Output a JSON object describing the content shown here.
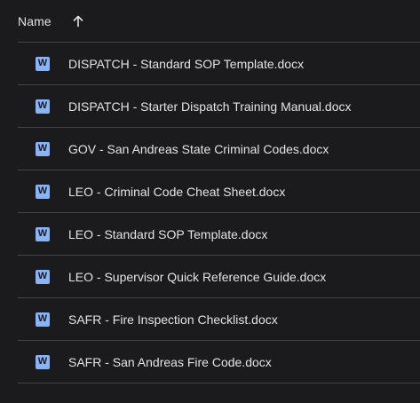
{
  "header": {
    "name_label": "Name",
    "sort_icon": "arrow-up-icon"
  },
  "colors": {
    "background": "#1b1b1e",
    "divider": "#444448",
    "text": "#e3e3e3",
    "word_icon": "#8ab4f8"
  },
  "files": [
    {
      "name": "DISPATCH - Standard SOP Template.docx",
      "icon": "word-icon",
      "icon_letter": "W"
    },
    {
      "name": "DISPATCH - Starter Dispatch Training Manual.docx",
      "icon": "word-icon",
      "icon_letter": "W"
    },
    {
      "name": "GOV - San Andreas State Criminal Codes.docx",
      "icon": "word-icon",
      "icon_letter": "W"
    },
    {
      "name": "LEO - Criminal Code Cheat Sheet.docx",
      "icon": "word-icon",
      "icon_letter": "W"
    },
    {
      "name": "LEO - Standard SOP Template.docx",
      "icon": "word-icon",
      "icon_letter": "W"
    },
    {
      "name": "LEO - Supervisor Quick Reference Guide.docx",
      "icon": "word-icon",
      "icon_letter": "W"
    },
    {
      "name": "SAFR - Fire Inspection Checklist.docx",
      "icon": "word-icon",
      "icon_letter": "W"
    },
    {
      "name": "SAFR - San Andreas Fire Code.docx",
      "icon": "word-icon",
      "icon_letter": "W"
    }
  ]
}
